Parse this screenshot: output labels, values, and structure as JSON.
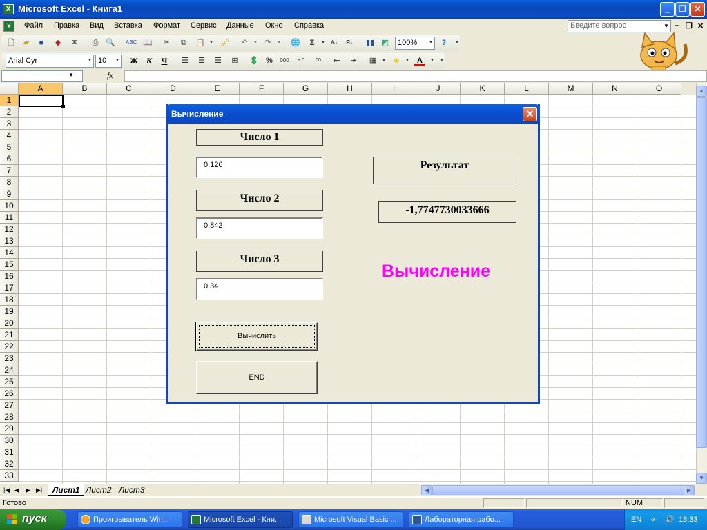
{
  "window": {
    "title": "Microsoft Excel - Книга1",
    "app_icon": "X",
    "buttons": {
      "minimize": "_",
      "restore": "❐",
      "close": "✕"
    }
  },
  "menu": {
    "items": [
      "Файл",
      "Правка",
      "Вид",
      "Вставка",
      "Формат",
      "Сервис",
      "Данные",
      "Окно",
      "Справка"
    ],
    "ask_question_placeholder": "Введите вопрос",
    "doc_controls": {
      "minimize": "–",
      "restore": "❐",
      "close": "✕"
    }
  },
  "toolbar_standard": {
    "zoom": "100%",
    "sigma": "Σ"
  },
  "toolbar_format": {
    "font": "Arial Cyr",
    "size": "10",
    "bold": "Ж",
    "italic": "К",
    "underline": "Ч",
    "percent": "%",
    "thousands": "000",
    "font_color": "A"
  },
  "formula_bar": {
    "name_box": "",
    "fx": "fx",
    "formula": ""
  },
  "sheet": {
    "columns": [
      "A",
      "B",
      "C",
      "D",
      "E",
      "F",
      "G",
      "H",
      "I",
      "J",
      "K",
      "L",
      "M",
      "N",
      "O"
    ],
    "rows": [
      "1",
      "2",
      "3",
      "4",
      "5",
      "6",
      "7",
      "8",
      "9",
      "10",
      "11",
      "12",
      "13",
      "14",
      "15",
      "16",
      "17",
      "18",
      "19",
      "20",
      "21",
      "22",
      "23",
      "24",
      "25",
      "26",
      "27",
      "28",
      "29",
      "30",
      "31",
      "32",
      "33"
    ],
    "active_cell": "A1",
    "tabs": [
      "Лист1",
      "Лист2",
      "Лист3"
    ],
    "active_tab": "Лист1"
  },
  "status": {
    "text": "Готово",
    "num": "NUM"
  },
  "dialog": {
    "title": "Вычисление",
    "close": "✕",
    "label1": "Число 1",
    "value1": "0.126",
    "label2": "Число 2",
    "value2": "0.842",
    "label3": "Число 3",
    "value3": "0.34",
    "result_label": "Результат",
    "result_value": "-1,7747730033666",
    "big_title": "Вычисление",
    "calc_button": "Вычислить",
    "end_button": "END"
  },
  "taskbar": {
    "start": "пуск",
    "tasks": [
      "Проигрыватель Win...",
      "Microsoft Excel - Кни...",
      "Microsoft Visual Basic ...",
      "Лабораторная рабо..."
    ],
    "lang": "EN",
    "clock": "18:33"
  },
  "colors": {
    "accent_title": "#0a4fd0",
    "big_title": "#ff00ff",
    "active_header": "#f9c76a",
    "start_green": "#2e8b2e"
  }
}
